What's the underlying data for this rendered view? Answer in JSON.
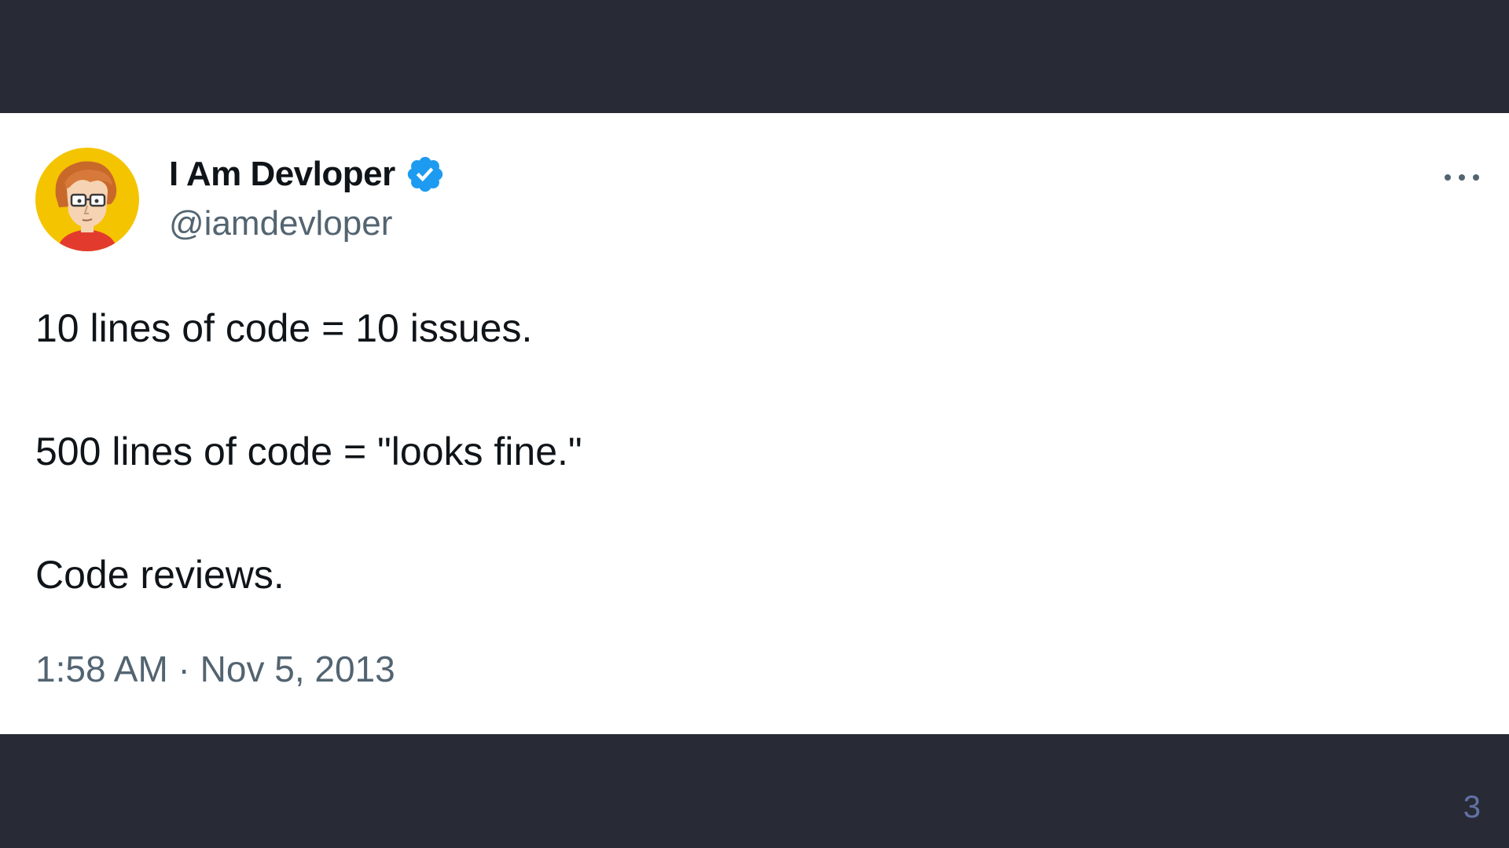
{
  "tweet": {
    "author": {
      "display_name": "I Am Devloper",
      "handle": "@iamdevloper",
      "verified": true,
      "avatar_icon": "cartoon-developer-avatar",
      "avatar_bg": "#f5c400"
    },
    "more_icon": "more-horizontal-icon",
    "text_lines": [
      "10 lines of code = 10 issues.",
      "500 lines of code = \"looks fine.\"",
      "Code reviews."
    ],
    "timestamp": "1:58 AM · Nov 5, 2013"
  },
  "slide": {
    "page_number": "3"
  },
  "colors": {
    "background": "#282a36",
    "card": "#ffffff",
    "text_primary": "#0f1419",
    "text_secondary": "#536471",
    "verified_badge": "#1d9bf0",
    "page_number": "#6272a4"
  }
}
